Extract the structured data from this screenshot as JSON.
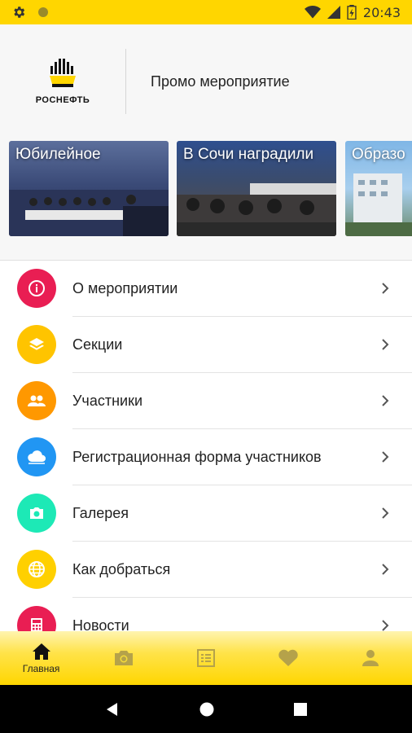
{
  "status_bar": {
    "time": "20:43",
    "icons": [
      "gear-icon",
      "circle-icon",
      "wifi-icon",
      "signal-icon",
      "battery-icon"
    ],
    "background": "#FFD600"
  },
  "header": {
    "logo_text": "РОСНЕФТЬ",
    "title": "Промо мероприятие"
  },
  "carousel": {
    "slides": [
      {
        "caption": "Юбилейное"
      },
      {
        "caption": "В Сочи наградили"
      },
      {
        "caption": "Образо"
      }
    ]
  },
  "menu": {
    "items": [
      {
        "label": "О мероприятии",
        "icon": "info-icon",
        "color": "#E91E53"
      },
      {
        "label": "Секции",
        "icon": "layers-icon",
        "color": "#FFC400"
      },
      {
        "label": "Участники",
        "icon": "people-icon",
        "color": "#FF9800"
      },
      {
        "label": "Регистрационная форма участников",
        "icon": "cloud-icon",
        "color": "#2196F3"
      },
      {
        "label": "Галерея",
        "icon": "camera-icon",
        "color": "#1DE9B6"
      },
      {
        "label": "Как добраться",
        "icon": "globe-icon",
        "color": "#FFD000"
      },
      {
        "label": "Новости",
        "icon": "calculator-icon",
        "color": "#E91E53"
      }
    ]
  },
  "bottom_nav": {
    "items": [
      {
        "label": "Главная",
        "icon": "home-icon",
        "active": true
      },
      {
        "label": "",
        "icon": "camera-icon",
        "active": false
      },
      {
        "label": "",
        "icon": "list-icon",
        "active": false
      },
      {
        "label": "",
        "icon": "heart-icon",
        "active": false
      },
      {
        "label": "",
        "icon": "person-icon",
        "active": false
      }
    ]
  },
  "system_nav": {
    "buttons": [
      "back-icon",
      "home-circle-icon",
      "recents-icon"
    ]
  }
}
